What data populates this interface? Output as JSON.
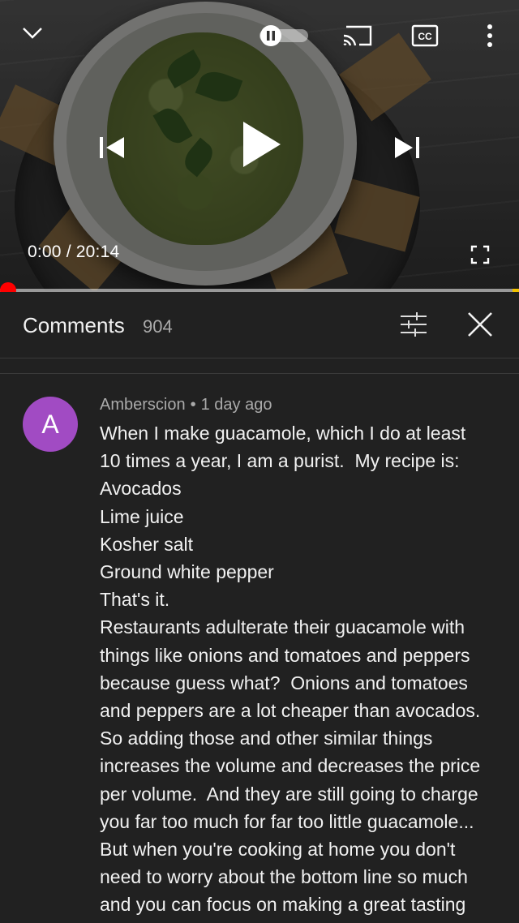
{
  "player": {
    "current_time": "0:00",
    "separator": " / ",
    "duration": "20:14",
    "progress_fraction": 0.0,
    "accent_color": "#ff0000"
  },
  "icons": {
    "collapse": "chevron-down-icon",
    "autoplay": "autoplay-toggle-icon",
    "cast": "cast-icon",
    "captions": "closed-captions-icon",
    "captions_text": "CC",
    "more": "more-vert-icon",
    "previous": "skip-previous-icon",
    "play": "play-icon",
    "next": "skip-next-icon",
    "fullscreen": "fullscreen-icon",
    "sort": "sort-filter-icon",
    "close": "close-icon"
  },
  "comments": {
    "title": "Comments",
    "count": "904"
  },
  "comment": {
    "avatar_letter": "A",
    "avatar_color": "#a14bc3",
    "author": "Amberscion",
    "bullet": "•",
    "age": "1 day ago",
    "lines": [
      "When I make guacamole, which I do at least",
      "10 times a year, I am a purist.  My recipe is:",
      "Avocados",
      "Lime juice",
      "Kosher salt",
      "Ground white pepper",
      "That's it.",
      "Restaurants adulterate their guacamole with",
      "things like onions and tomatoes and peppers",
      "because guess what?  Onions and tomatoes",
      "and peppers are a lot cheaper than avocados.",
      "So adding those and other similar things",
      "increases the volume and decreases the price",
      "per volume.  And they are still going to charge",
      "you far too much for far too little guacamole...",
      "But when you're cooking at home you don't",
      "need to worry about the bottom line so much",
      "and you can focus on making a great tasting"
    ]
  }
}
